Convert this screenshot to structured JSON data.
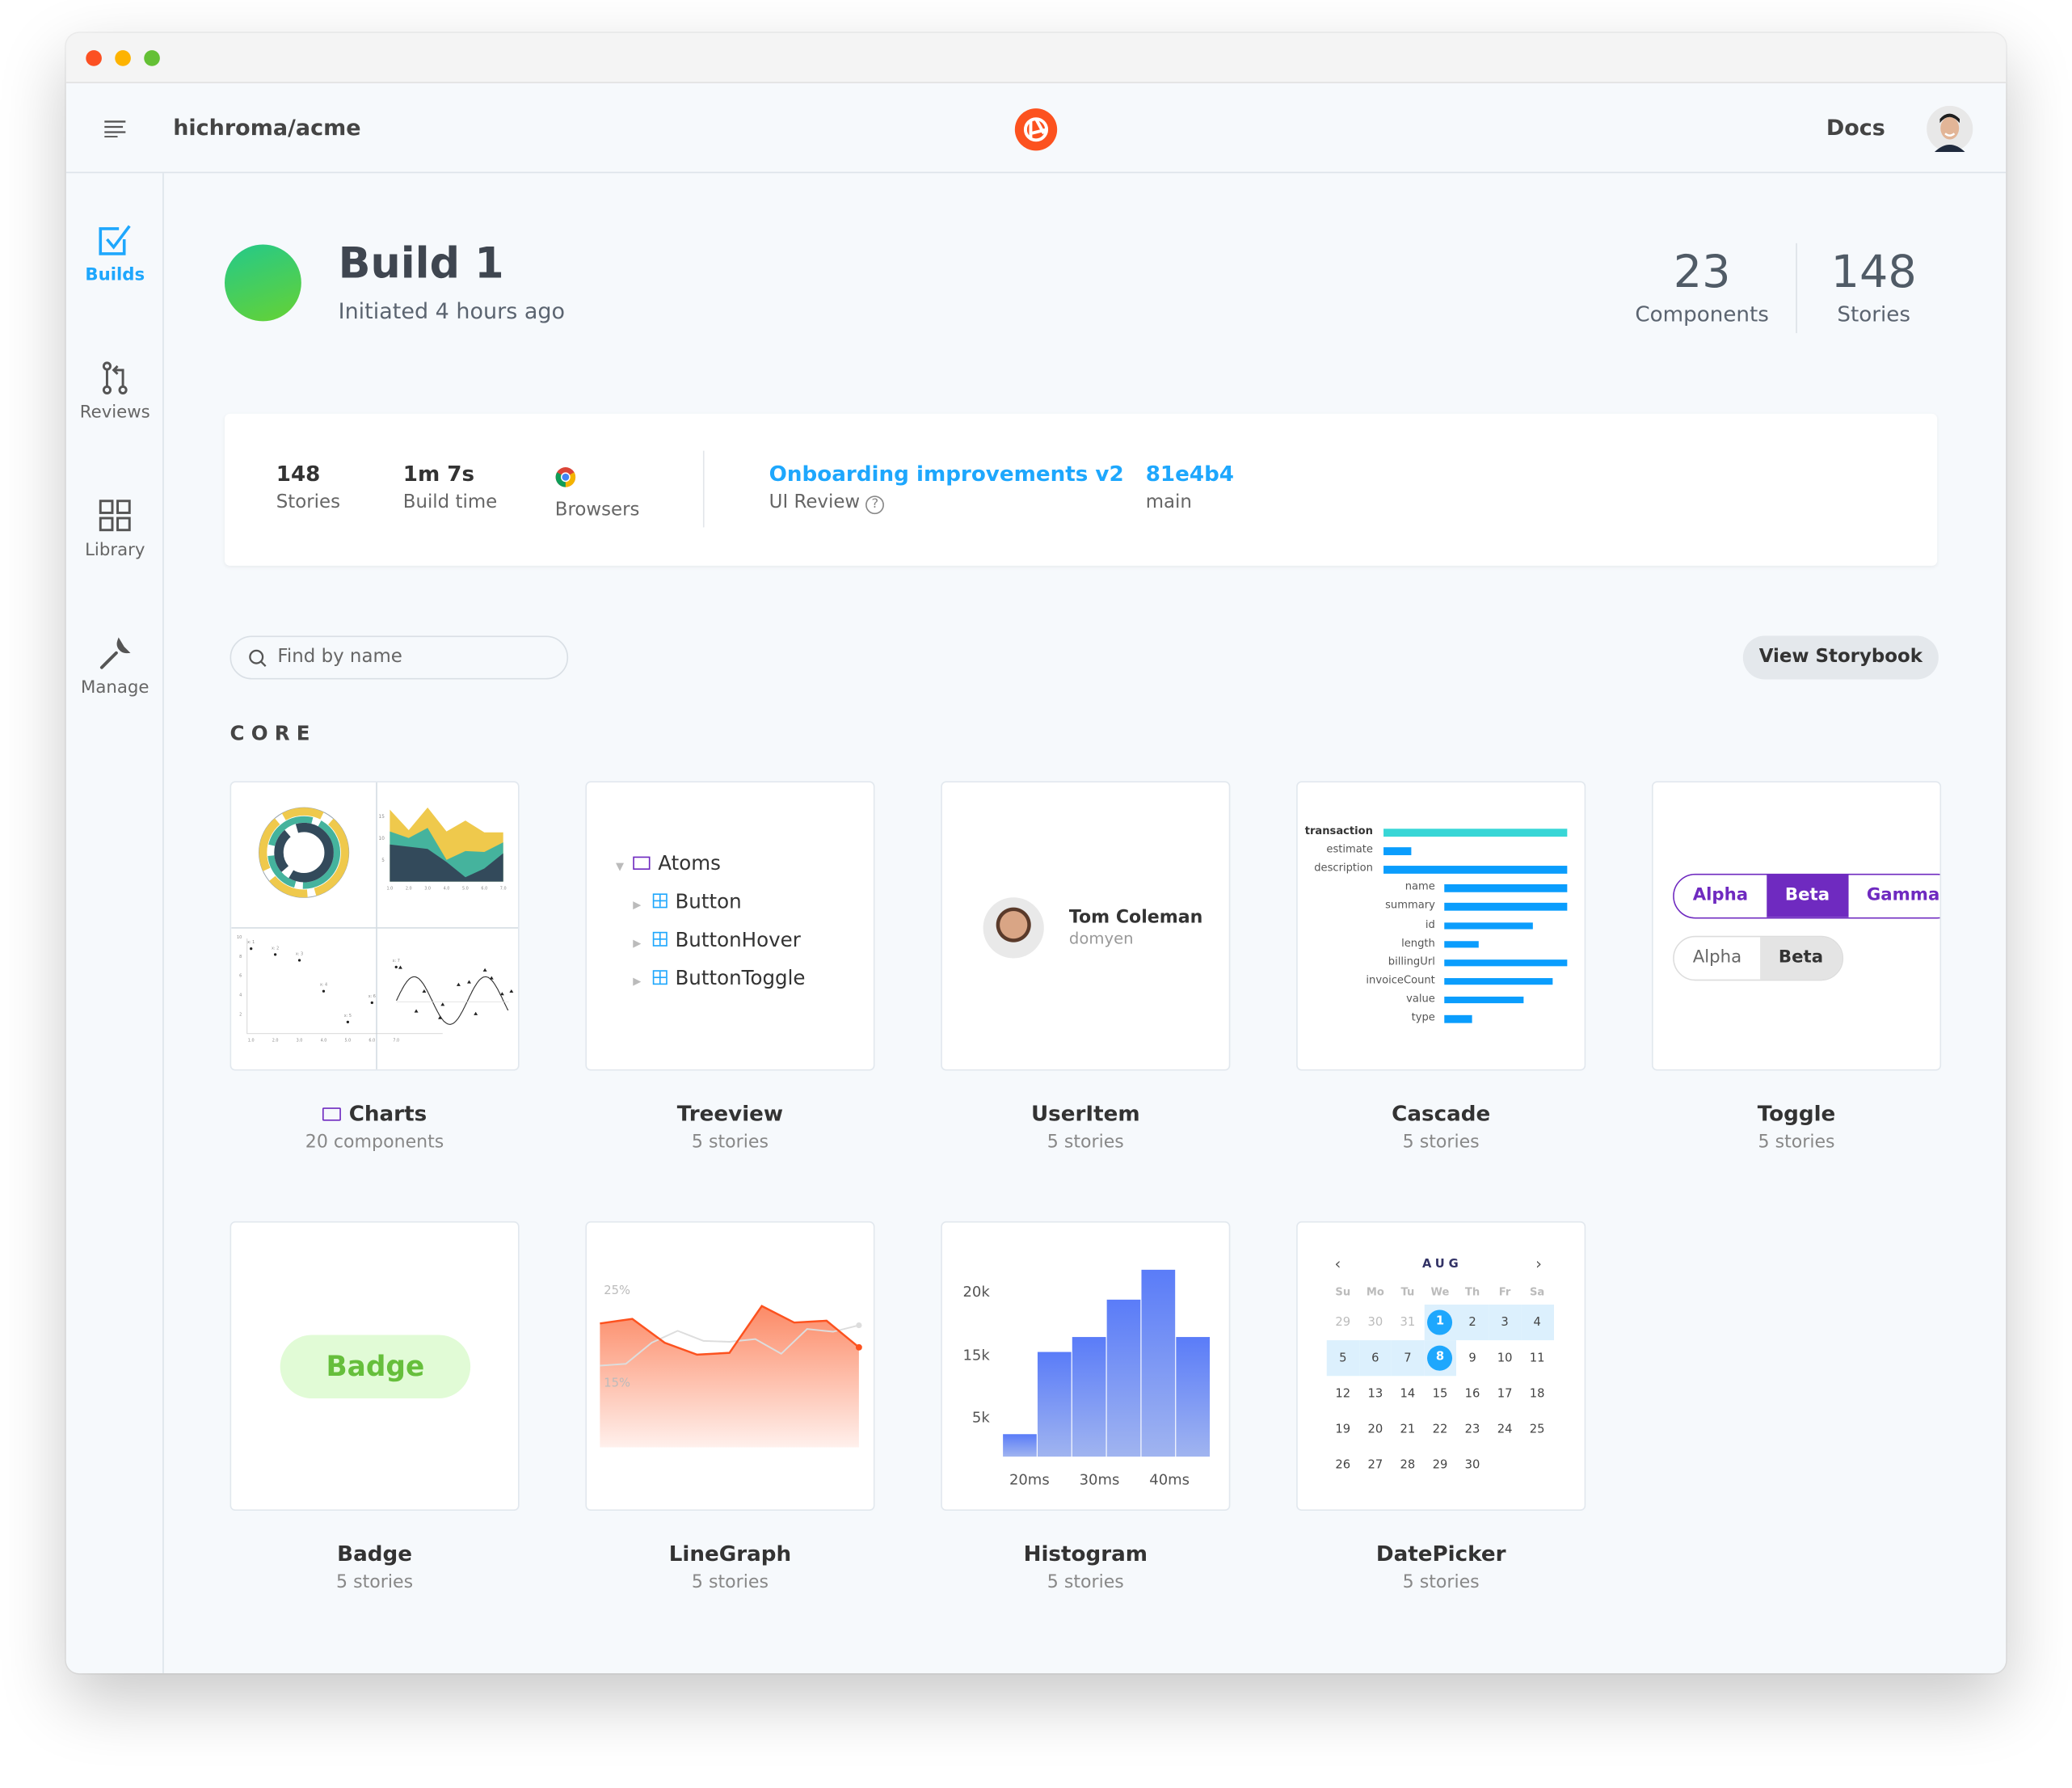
{
  "window": {
    "traffic_lights": [
      "#fc5022",
      "#fdb300",
      "#64c035"
    ]
  },
  "header": {
    "repo": "hichroma/acme",
    "docs": "Docs",
    "logo_color": "#fc521f"
  },
  "sidebar": {
    "items": [
      {
        "label": "Builds",
        "icon": "checkbox-icon",
        "active": true
      },
      {
        "label": "Reviews",
        "icon": "pull-request-icon"
      },
      {
        "label": "Library",
        "icon": "grid-icon"
      },
      {
        "label": "Manage",
        "icon": "wrench-icon"
      }
    ],
    "accent": "#1ea7fd"
  },
  "build": {
    "title": "Build 1",
    "subtitle": "Initiated 4 hours ago",
    "status_color": "#3bd07a"
  },
  "totals": {
    "components_value": "23",
    "components_label": "Components",
    "stories_value": "148",
    "stories_label": "Stories"
  },
  "info": {
    "stories_value": "148",
    "stories_label": "Stories",
    "build_time_value": "1m 7s",
    "build_time_label": "Build time",
    "browsers_label": "Browsers",
    "browser_icon": "chrome-icon",
    "pr_title": "Onboarding improvements v2",
    "pr_sub": "UI Review",
    "commit": "81e4b4",
    "branch": "main"
  },
  "search": {
    "placeholder": "Find by name"
  },
  "view_storybook": "View Storybook",
  "section": "CORE",
  "cards": [
    {
      "title": "Charts",
      "sub": "20 components",
      "folder": true
    },
    {
      "title": "Treeview",
      "sub": "5 stories"
    },
    {
      "title": "UserItem",
      "sub": "5 stories"
    },
    {
      "title": "Cascade",
      "sub": "5 stories"
    },
    {
      "title": "Toggle",
      "sub": "5 stories"
    },
    {
      "title": "Badge",
      "sub": "5 stories"
    },
    {
      "title": "LineGraph",
      "sub": "5 stories"
    },
    {
      "title": "Histogram",
      "sub": "5 stories"
    },
    {
      "title": "DatePicker",
      "sub": "5 stories"
    }
  ],
  "charts_thumb": {
    "area_yticks": [
      "15",
      "10",
      "5"
    ],
    "area_xticks": [
      "1.0",
      "2.0",
      "3.0",
      "4.0",
      "5.0",
      "6.0",
      "7.0"
    ],
    "scatter_yticks": [
      "10",
      "8",
      "6",
      "4",
      "2"
    ],
    "scatter_xticks": [
      "1.0",
      "2.0",
      "3.0",
      "4.0",
      "5.0",
      "6.0",
      "7.0"
    ],
    "scatter_points": [
      {
        "x": 1,
        "y": 8.8,
        "label": "x: 1"
      },
      {
        "x": 2,
        "y": 8.2,
        "label": "x: 2"
      },
      {
        "x": 3,
        "y": 7.6,
        "label": "x: 3"
      },
      {
        "x": 4,
        "y": 4.4,
        "label": "x: 4"
      },
      {
        "x": 5,
        "y": 1.2,
        "label": "x: 5"
      },
      {
        "x": 6,
        "y": 3.2,
        "label": "x: 6"
      },
      {
        "x": 7,
        "y": 6.9,
        "label": "x: 7"
      }
    ],
    "colors": [
      "#334a5b",
      "#45b39d",
      "#efc94c"
    ]
  },
  "treeview": {
    "root": "Atoms",
    "children": [
      "Button",
      "ButtonHover",
      "ButtonToggle"
    ]
  },
  "useritem": {
    "name": "Tom Coleman",
    "handle": "domyen"
  },
  "cascade": {
    "rows": [
      {
        "label": "transaction",
        "value": 1.0,
        "level": 0,
        "bold": true
      },
      {
        "label": "estimate",
        "value": 0.15,
        "level": 0
      },
      {
        "label": "description",
        "value": 1.0,
        "level": 0
      },
      {
        "label": "name",
        "value": 1.0,
        "level": 1
      },
      {
        "label": "summary",
        "value": 1.0,
        "level": 1
      },
      {
        "label": "id",
        "value": 0.72,
        "level": 1
      },
      {
        "label": "length",
        "value": 0.28,
        "level": 1
      },
      {
        "label": "billingUrl",
        "value": 1.0,
        "level": 1
      },
      {
        "label": "invoiceCount",
        "value": 0.88,
        "level": 1
      },
      {
        "label": "value",
        "value": 0.64,
        "level": 1
      },
      {
        "label": "type",
        "value": 0.23,
        "level": 1
      }
    ],
    "highlight": "#38d6d6",
    "bar": "#0a9dfd"
  },
  "toggle": {
    "group1": [
      "Alpha",
      "Beta",
      "Gamma"
    ],
    "group1_selected": "Beta",
    "group2": [
      "Alpha",
      "Beta"
    ],
    "group2_selected": "Beta",
    "accent": "#6f2ac0"
  },
  "badge": {
    "label": "Badge",
    "bg": "#e1fbd6",
    "fg": "#66bf3c"
  },
  "linegraph": {
    "yticks": [
      "25%",
      "15%"
    ],
    "ylim": [
      8,
      25
    ],
    "series": [
      {
        "color": "#fc521f",
        "values": [
          21.5,
          22,
          19.4,
          18.1,
          18.3,
          23.4,
          21.6,
          21.8,
          18.9
        ]
      },
      {
        "color": "#dddddd",
        "values": [
          16.9,
          17.1,
          19.4,
          20.7,
          19.6,
          19.5,
          19.8,
          18.2,
          20.9,
          20.6,
          21.3
        ]
      }
    ]
  },
  "histogram": {
    "yticks": [
      "20k",
      "15k",
      "5k"
    ],
    "xticks": [
      "20ms",
      "30ms",
      "40ms"
    ],
    "values": [
      3,
      14,
      16,
      21,
      25,
      16
    ],
    "ylim": [
      0,
      26
    ],
    "color": "#5a7cf8"
  },
  "datepicker": {
    "month": "AUG",
    "weekdays": [
      "Su",
      "Mo",
      "Tu",
      "We",
      "Th",
      "Fr",
      "Sa"
    ],
    "weeks": [
      [
        "29",
        "30",
        "31",
        "1",
        "2",
        "3",
        "4"
      ],
      [
        "5",
        "6",
        "7",
        "8",
        "9",
        "10",
        "11"
      ],
      [
        "12",
        "13",
        "14",
        "15",
        "16",
        "17",
        "18"
      ],
      [
        "19",
        "20",
        "21",
        "22",
        "23",
        "24",
        "25"
      ],
      [
        "26",
        "27",
        "28",
        "29",
        "30",
        "",
        ""
      ]
    ],
    "range_start": "1",
    "range_end": "8",
    "accent": "#1ea7fd"
  }
}
